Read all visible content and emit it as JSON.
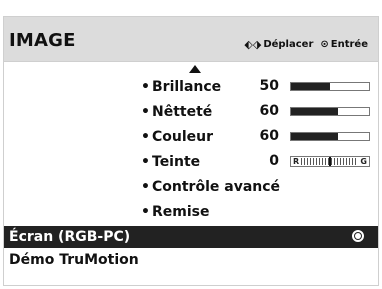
{
  "header": {
    "title": "IMAGE",
    "hint_move": "Déplacer",
    "hint_enter": "Entrée",
    "icons": {
      "move": "four-way-arrow-icon",
      "ok": "ok-circle-icon"
    }
  },
  "submenu": {
    "items": [
      {
        "label": "Brillance",
        "value": "50",
        "level": 0.5
      },
      {
        "label": "Nêtteté",
        "value": "60",
        "level": 0.6
      },
      {
        "label": "Couleur",
        "value": "60",
        "level": 0.6
      },
      {
        "label": "Teinte",
        "value": "0",
        "left_cap": "R",
        "right_cap": "G"
      },
      {
        "label": "Contrôle avancé"
      },
      {
        "label": "Remise"
      }
    ],
    "bullet": "•"
  },
  "main_items": [
    {
      "label": "Écran (RGB-PC)",
      "selected": true
    },
    {
      "label": "Démo TruMotion"
    }
  ],
  "colors": {
    "header_bg": "#dcdcdc",
    "highlight_bg": "#222222",
    "highlight_text": "#ffffff"
  }
}
